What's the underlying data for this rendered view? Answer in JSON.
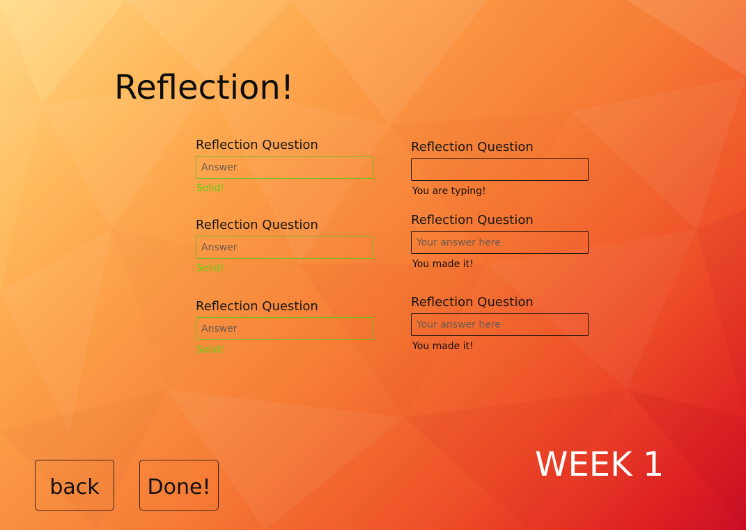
{
  "page": {
    "title": "Reflection!",
    "week_label": "WEEK 1"
  },
  "questions_left": [
    {
      "label": "Reflection Question",
      "value": "",
      "placeholder": "Answer",
      "feedback": "Solid!",
      "state": "valid"
    },
    {
      "label": "Reflection Question",
      "value": "",
      "placeholder": "Answer",
      "feedback": "Solid!",
      "state": "valid"
    },
    {
      "label": "Reflection Question",
      "value": "",
      "placeholder": "Answer",
      "feedback": "Solid!",
      "state": "valid"
    }
  ],
  "questions_right": [
    {
      "label": "Reflection Question",
      "value": "",
      "placeholder": "",
      "feedback": "You are typing!",
      "state": "typing"
    },
    {
      "label": "Reflection Question",
      "value": "",
      "placeholder": "Your answer here",
      "feedback": "You made it!",
      "state": "done"
    },
    {
      "label": "Reflection Question",
      "value": "",
      "placeholder": "Your answer here",
      "feedback": "You made it!",
      "state": "done"
    }
  ],
  "buttons": {
    "back_label": "back",
    "done_label": "Done!"
  },
  "colors": {
    "valid_accent": "#5fd20b",
    "input_border_dark": "#2a1710",
    "title_text": "#0d0d0d",
    "week_text": "#ffffff"
  }
}
